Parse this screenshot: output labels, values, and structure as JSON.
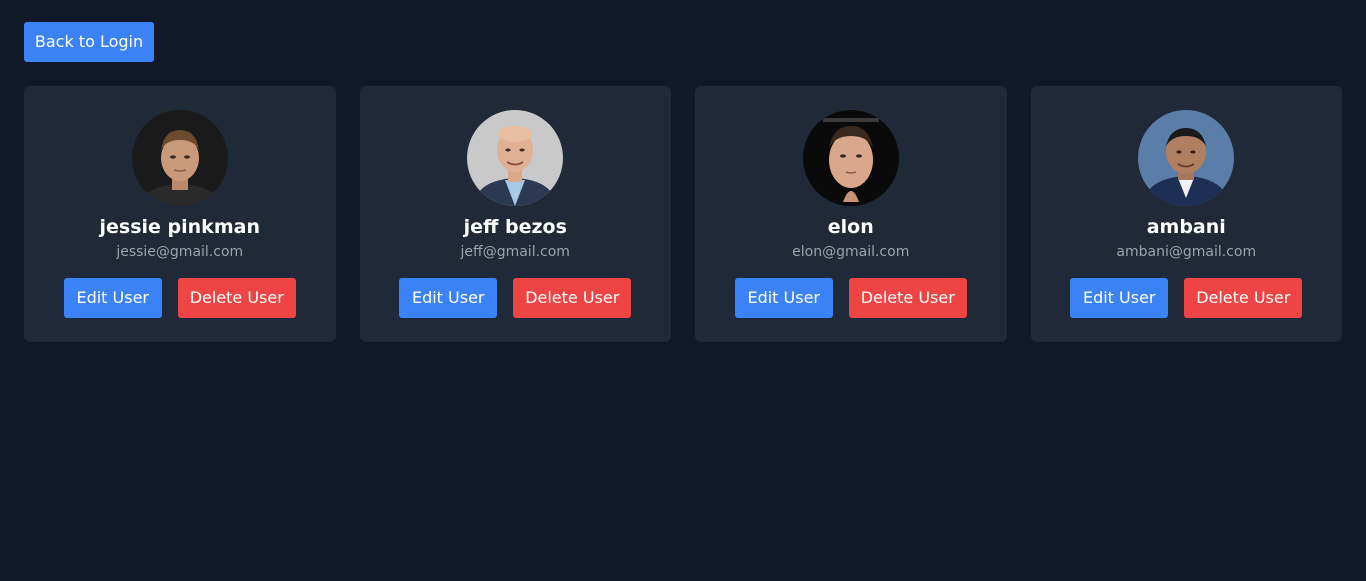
{
  "header": {
    "back_label": "Back to Login"
  },
  "colors": {
    "background": "#111827",
    "card": "#1f2937",
    "primary": "#3b82f6",
    "danger": "#ef4444",
    "muted_text": "#9ca3af"
  },
  "users": [
    {
      "name": "jessie pinkman",
      "email": "jessie@gmail.com",
      "avatar_icon": "person-photo-dark-icon",
      "edit_label": "Edit User",
      "delete_label": "Delete User"
    },
    {
      "name": "jeff bezos",
      "email": "jeff@gmail.com",
      "avatar_icon": "person-photo-light-icon",
      "edit_label": "Edit User",
      "delete_label": "Delete User"
    },
    {
      "name": "elon",
      "email": "elon@gmail.com",
      "avatar_icon": "person-photo-dark-icon",
      "edit_label": "Edit User",
      "delete_label": "Delete User"
    },
    {
      "name": "ambani",
      "email": "ambani@gmail.com",
      "avatar_icon": "person-photo-blue-icon",
      "edit_label": "Edit User",
      "delete_label": "Delete User"
    }
  ]
}
